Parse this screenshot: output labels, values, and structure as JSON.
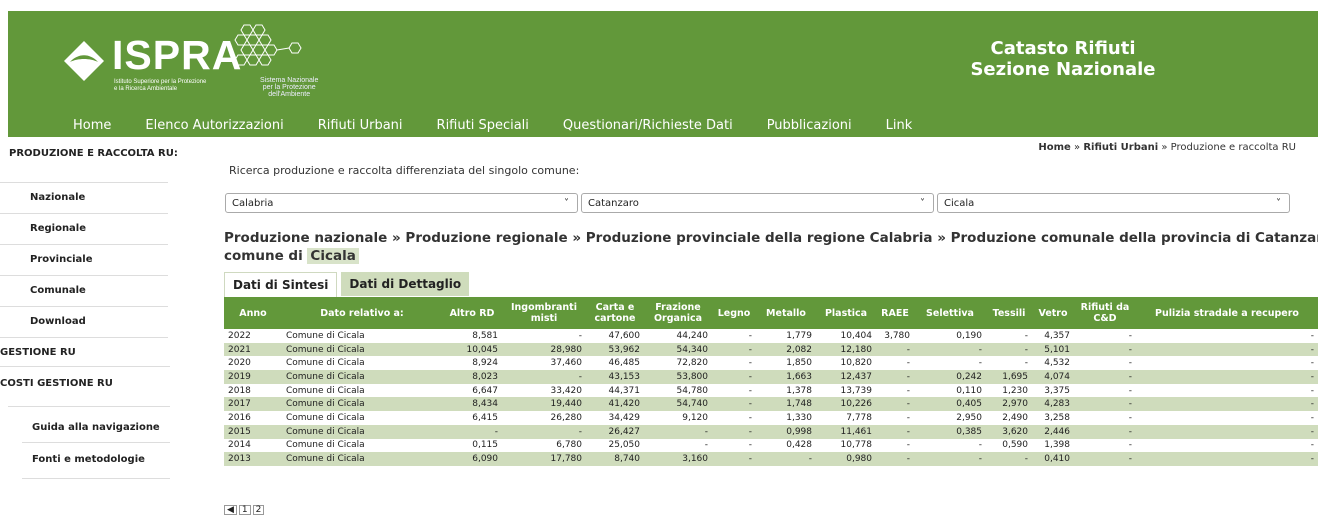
{
  "header": {
    "logo_text": "ISPRA",
    "logo_sub": [
      "Istituto Superiore per la Protezione",
      "e la Ricerca Ambientale"
    ],
    "snpa": [
      "Sistema Nazionale",
      "per la Protezione",
      "dell'Ambiente"
    ],
    "title_lines": [
      "Catasto Rifiuti",
      "Sezione Nazionale"
    ]
  },
  "nav": [
    "Home",
    "Elenco Autorizzazioni",
    "Rifiuti Urbani",
    "Rifiuti Speciali",
    "Questionari/Richieste Dati",
    "Pubblicazioni",
    "Link"
  ],
  "sidebar": {
    "heading": "PRODUZIONE E RACCOLTA RU:",
    "items": [
      "Nazionale",
      "Regionale",
      "Provinciale",
      "Comunale",
      "Download"
    ],
    "gestione": "GESTIONE RU",
    "costi": "COSTI GESTIONE RU",
    "guida": "Guida alla navigazione",
    "fonti": "Fonti e metodologie"
  },
  "breadcrumb": {
    "home": "Home",
    "sep": "»",
    "section": "Rifiuti Urbani",
    "current": "Produzione e raccolta RU"
  },
  "search_label": "Ricerca produzione e raccolta differenziata del singolo comune:",
  "selects": {
    "region": "Calabria",
    "province": "Catanzaro",
    "comune": "Cicala"
  },
  "path": {
    "line1": "Produzione nazionale » Produzione regionale » Produzione provinciale della regione Calabria » Produzione comunale della provincia di Catanzaro » Produzione del",
    "line2_prefix": "comune di ",
    "line2_hl": "Cicala"
  },
  "tabs": [
    "Dati di Sintesi",
    "Dati di Dettaglio"
  ],
  "table": {
    "headers": [
      "Anno",
      "Dato relativo a:",
      "Altro RD",
      "Ingombranti misti",
      "Carta e cartone",
      "Frazione Organica",
      "Legno",
      "Metallo",
      "Plastica",
      "RAEE",
      "Selettiva",
      "Tessili",
      "Vetro",
      "Rifiuti da C&D",
      "Pulizia stradale a recupero"
    ],
    "rows": [
      [
        "2022",
        "Comune di Cicala",
        "8,581",
        "-",
        "47,600",
        "44,240",
        "-",
        "1,779",
        "10,404",
        "3,780",
        "0,190",
        "-",
        "4,357",
        "-",
        "-"
      ],
      [
        "2021",
        "Comune di Cicala",
        "10,045",
        "28,980",
        "53,962",
        "54,340",
        "-",
        "2,082",
        "12,180",
        "-",
        "-",
        "-",
        "5,101",
        "-",
        "-"
      ],
      [
        "2020",
        "Comune di Cicala",
        "8,924",
        "37,460",
        "46,485",
        "72,820",
        "-",
        "1,850",
        "10,820",
        "-",
        "-",
        "-",
        "4,532",
        "-",
        "-"
      ],
      [
        "2019",
        "Comune di Cicala",
        "8,023",
        "-",
        "43,153",
        "53,800",
        "-",
        "1,663",
        "12,437",
        "-",
        "0,242",
        "1,695",
        "4,074",
        "-",
        "-"
      ],
      [
        "2018",
        "Comune di Cicala",
        "6,647",
        "33,420",
        "44,371",
        "54,780",
        "-",
        "1,378",
        "13,739",
        "-",
        "0,110",
        "1,230",
        "3,375",
        "-",
        "-"
      ],
      [
        "2017",
        "Comune di Cicala",
        "8,434",
        "19,440",
        "41,420",
        "54,740",
        "-",
        "1,748",
        "10,226",
        "-",
        "0,405",
        "2,970",
        "4,283",
        "-",
        "-"
      ],
      [
        "2016",
        "Comune di Cicala",
        "6,415",
        "26,280",
        "34,429",
        "9,120",
        "-",
        "1,330",
        "7,778",
        "-",
        "2,950",
        "2,490",
        "3,258",
        "-",
        "-"
      ],
      [
        "2015",
        "Comune di Cicala",
        "-",
        "-",
        "26,427",
        "-",
        "-",
        "0,998",
        "11,461",
        "-",
        "0,385",
        "3,620",
        "2,446",
        "-",
        "-"
      ],
      [
        "2014",
        "Comune di Cicala",
        "0,115",
        "6,780",
        "25,050",
        "-",
        "-",
        "0,428",
        "10,778",
        "-",
        "-",
        "0,590",
        "1,398",
        "-",
        "-"
      ],
      [
        "2013",
        "Comune di Cicala",
        "6,090",
        "17,780",
        "8,740",
        "3,160",
        "-",
        "-",
        "0,980",
        "-",
        "-",
        "-",
        "0,410",
        "-",
        "-"
      ]
    ]
  },
  "pager": [
    "1",
    "2"
  ],
  "colors": {
    "brand_green": "#62983a",
    "row_alt": "#cfdcbc"
  }
}
